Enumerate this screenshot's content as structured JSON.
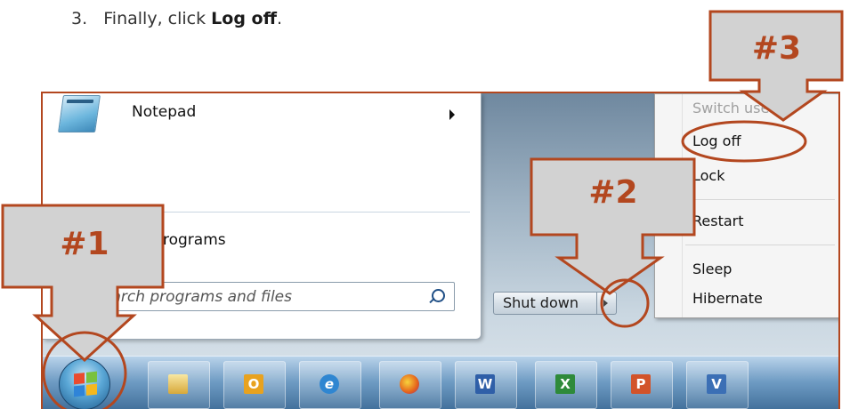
{
  "instruction": {
    "number": "3.",
    "prefix": "Finally, click",
    "target": "Log off",
    "suffix": "."
  },
  "start_menu": {
    "pinned_item": "Notepad",
    "all_programs_fragment": "rograms",
    "search_placeholder": "earch programs and files",
    "shutdown_label": "Shut down"
  },
  "power_menu": {
    "items": [
      {
        "label": "Switch user",
        "enabled": false
      },
      {
        "label": "Log off",
        "enabled": true
      },
      {
        "label": "Lock",
        "enabled": true
      },
      {
        "label": "Restart",
        "enabled": true
      },
      {
        "label": "Sleep",
        "enabled": true
      },
      {
        "label": "Hibernate",
        "enabled": true
      }
    ]
  },
  "taskbar": {
    "apps": [
      {
        "name": "file-explorer-icon",
        "glyph": ""
      },
      {
        "name": "outlook-icon",
        "glyph": "O"
      },
      {
        "name": "internet-explorer-icon",
        "glyph": "e"
      },
      {
        "name": "firefox-icon",
        "glyph": ""
      },
      {
        "name": "word-icon",
        "glyph": "W"
      },
      {
        "name": "excel-icon",
        "glyph": "X"
      },
      {
        "name": "powerpoint-icon",
        "glyph": "P"
      },
      {
        "name": "visio-icon",
        "glyph": "V"
      }
    ]
  },
  "callouts": [
    {
      "label": "#1"
    },
    {
      "label": "#2"
    },
    {
      "label": "#3"
    }
  ],
  "colors": {
    "accent": "#b3471f",
    "callout_fill": "#d2d2d2"
  }
}
